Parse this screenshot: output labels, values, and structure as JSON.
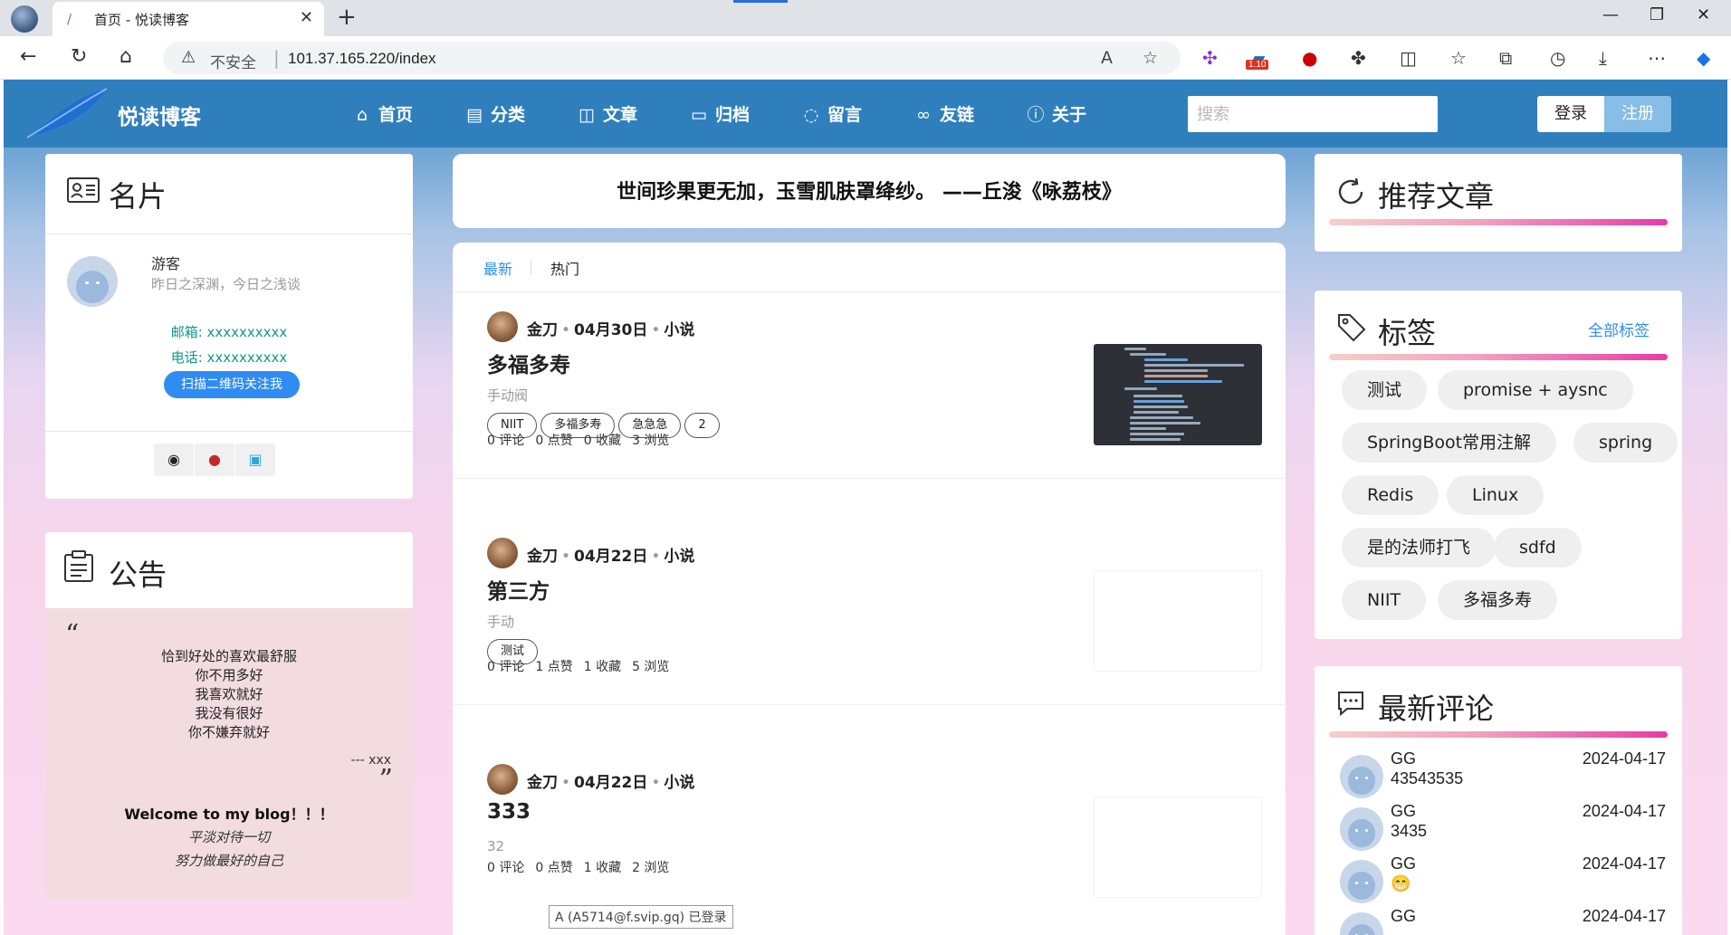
{
  "browser": {
    "tab_title": "首页 - 悦读博客",
    "insecure_label": "不安全",
    "url": "101.37.165.220/index",
    "extension_badge": "1.10"
  },
  "site": {
    "name": "悦读博客",
    "nav": [
      {
        "label": "首页",
        "icon": "home-icon"
      },
      {
        "label": "分类",
        "icon": "document-icon"
      },
      {
        "label": "文章",
        "icon": "book-icon"
      },
      {
        "label": "归档",
        "icon": "archive-icon"
      },
      {
        "label": "留言",
        "icon": "message-icon"
      },
      {
        "label": "友链",
        "icon": "link-icon"
      },
      {
        "label": "关于",
        "icon": "info-icon"
      }
    ],
    "search_placeholder": "搜索",
    "login": "登录",
    "register": "注册"
  },
  "profile": {
    "title": "名片",
    "name": "游客",
    "motto": "昨日之深渊，今日之浅谈",
    "email": "邮箱: xxxxxxxxxx",
    "phone": "电话: xxxxxxxxxx",
    "qr_button": "扫描二维码关注我"
  },
  "notice": {
    "title": "公告",
    "open_quote": "“",
    "close_quote": "”",
    "lines": [
      "恰到好处的喜欢最舒服",
      "你不用多好",
      "我喜欢就好",
      "我没有很好",
      "你不嫌弃就好"
    ],
    "author": "--- xxx",
    "welcome": "Welcome to my blog！！！",
    "italic_lines": [
      "平淡对待一切",
      "努力做最好的自己"
    ]
  },
  "quote": {
    "text": "世间珍果更无加，玉雪肌肤罩绛纱。   ——丘浚《咏荔枝》"
  },
  "feed": {
    "tabs": [
      "最新",
      "热门"
    ],
    "posts": [
      {
        "author": "金刀",
        "date": "04月30日",
        "category": "小说",
        "title": "多福多寿",
        "summary": "手动阀",
        "tags": [
          "NIIT",
          "多福多寿",
          "急急急",
          "2"
        ],
        "stats": [
          "0 评论",
          "0 点赞",
          "0 收藏",
          "3 浏览"
        ]
      },
      {
        "author": "金刀",
        "date": "04月22日",
        "category": "小说",
        "title": "第三方",
        "summary": "手动",
        "tags": [
          "测试"
        ],
        "stats": [
          "0 评论",
          "1 点赞",
          "1 收藏",
          "5 浏览"
        ]
      },
      {
        "author": "金刀",
        "date": "04月22日",
        "category": "小说",
        "title": "333",
        "summary": "32",
        "tags": [],
        "stats": [
          "0 评论",
          "0 点赞",
          "1 收藏",
          "2 浏览"
        ]
      }
    ]
  },
  "status_tooltip": "A (A5714@f.svip.gq) 已登录",
  "recommended": {
    "title": "推荐文章"
  },
  "tags": {
    "title": "标签",
    "all_link": "全部标签",
    "items": [
      "测试",
      "promise + aysnc",
      "SpringBoot常用注解",
      "spring",
      "Redis",
      "Linux",
      "是的法师打飞",
      "sdfd",
      "NIIT",
      "多福多寿"
    ]
  },
  "comments": {
    "title": "最新评论",
    "items": [
      {
        "name": "GG",
        "text": "43543535",
        "date": "2024-04-17"
      },
      {
        "name": "GG",
        "text": "3435",
        "date": "2024-04-17"
      },
      {
        "name": "GG",
        "text": "😁",
        "date": "2024-04-17"
      },
      {
        "name": "GG",
        "text": "",
        "date": "2024-04-17"
      }
    ]
  }
}
